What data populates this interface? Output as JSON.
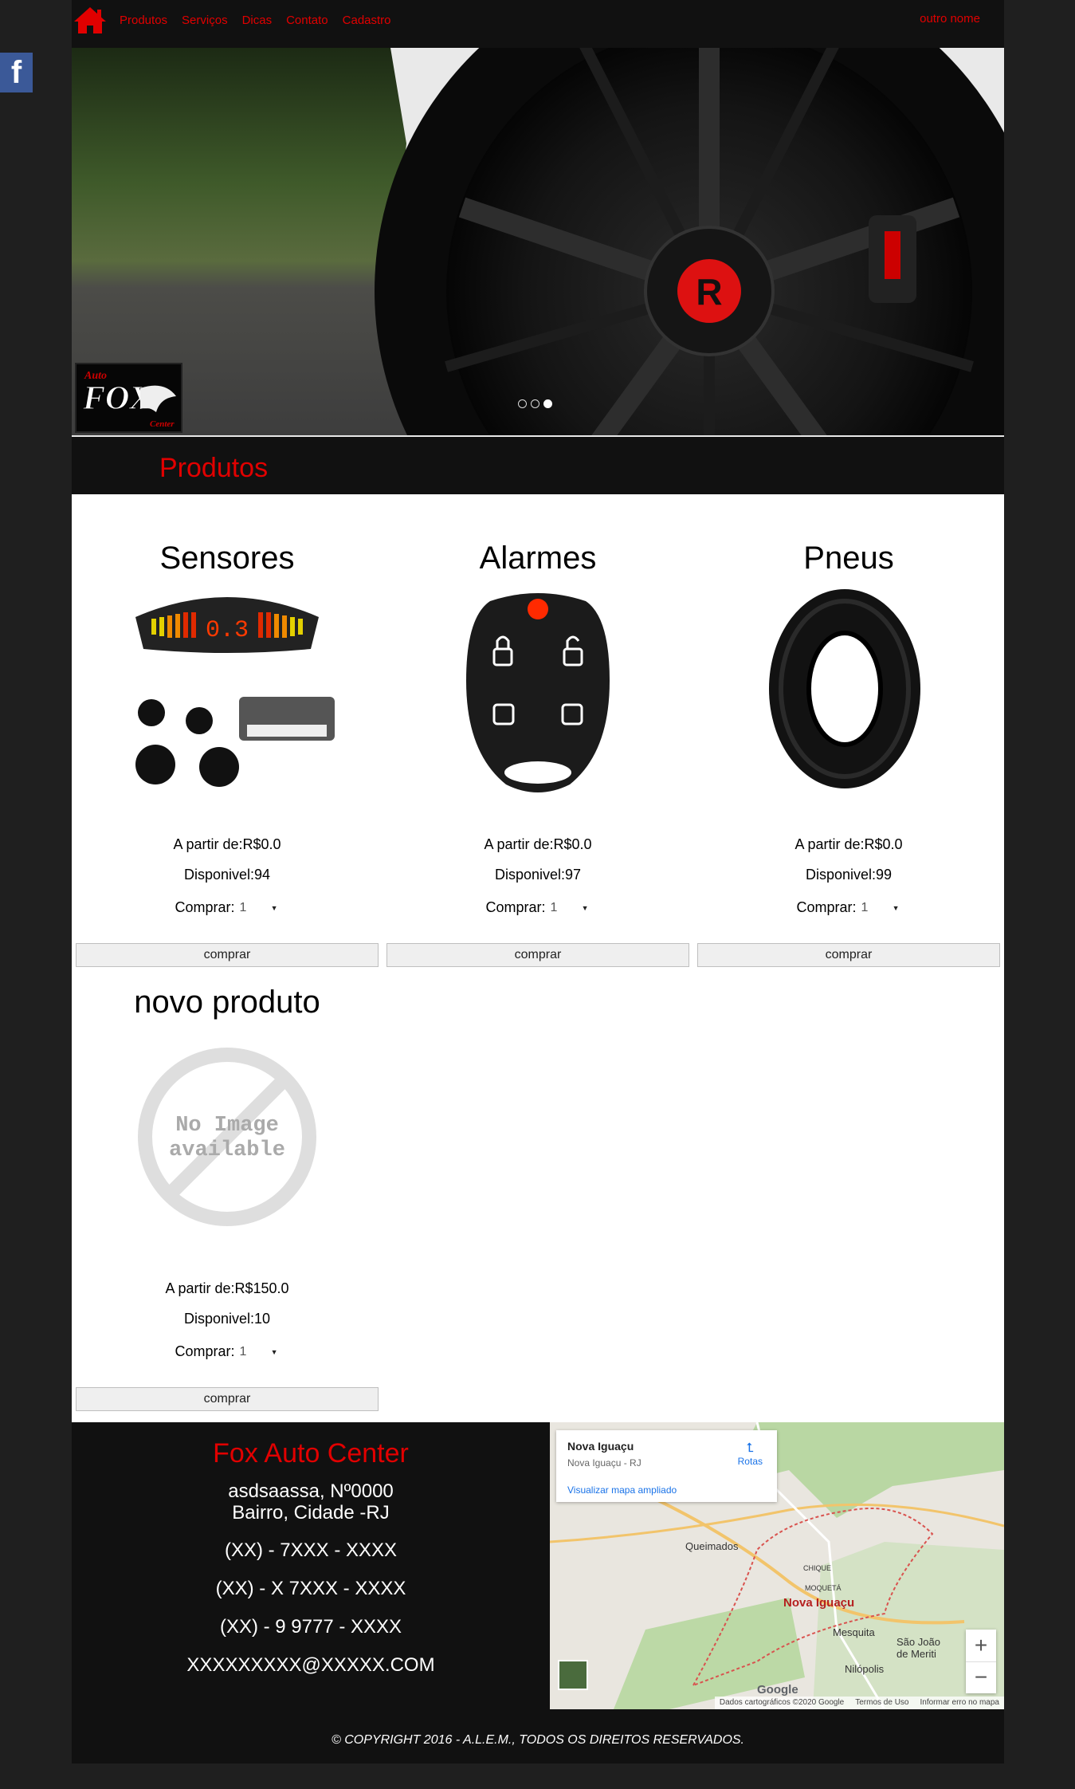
{
  "nav": {
    "items": [
      "Produtos",
      "Serviços",
      "Dicas",
      "Contato",
      "Cadastro"
    ],
    "user_label": "outro nome"
  },
  "hero": {
    "logo_text_top": "Auto",
    "logo_text_main": "FOX",
    "logo_text_bottom": "Center",
    "slide_count": 3,
    "active_slide": 3
  },
  "section": {
    "title": "Produtos"
  },
  "products": [
    {
      "name": "Sensores",
      "price_label": "A partir de:R$0.0",
      "avail_label": "Disponivel:94",
      "buy_label": "Comprar:",
      "qty": "1",
      "button": "comprar"
    },
    {
      "name": "Alarmes",
      "price_label": "A partir de:R$0.0",
      "avail_label": "Disponivel:97",
      "buy_label": "Comprar:",
      "qty": "1",
      "button": "comprar"
    },
    {
      "name": "Pneus",
      "price_label": "A partir de:R$0.0",
      "avail_label": "Disponivel:99",
      "buy_label": "Comprar:",
      "qty": "1",
      "button": "comprar"
    },
    {
      "name": "novo produto",
      "price_label": "A partir de:R$150.0",
      "avail_label": "Disponivel:10",
      "buy_label": "Comprar:",
      "qty": "1",
      "button": "comprar",
      "no_image_text": "No Image available"
    }
  ],
  "footer": {
    "company": "Fox Auto Center",
    "address_line1": "asdsaassa, Nº0000",
    "address_line2": "Bairro, Cidade -RJ",
    "phone1": "(XX) - 7XXX - XXXX",
    "phone2": "(XX) - X 7XXX - XXXX",
    "phone3": "(XX) - 9 9777 - XXXX",
    "email": "XXXXXXXXX@XXXXX.COM",
    "copyright": "© COPYRIGHT 2016 - A.L.E.M., TODOS OS DIREITOS RESERVADOS."
  },
  "map": {
    "place": "Nova Iguaçu",
    "place_sub": "Nova Iguaçu - RJ",
    "routes": "Rotas",
    "enlarge": "Visualizar mapa ampliado",
    "city_label": "Nova Iguaçu",
    "labels": [
      "Queimados",
      "Mesquita",
      "São João de Meriti",
      "Nilópolis",
      "CHIQUE",
      "MOQUETÁ"
    ],
    "google": "Google",
    "footer_items": [
      "Dados cartográficos ©2020 Google",
      "Termos de Uso",
      "Informar erro no mapa"
    ],
    "zoom_in": "+",
    "zoom_out": "−"
  },
  "social": {
    "facebook_letter": "f"
  },
  "colors": {
    "accent": "#e10000",
    "background": "#1f1f1f",
    "panel": "#111111",
    "facebook": "#3b5998"
  }
}
